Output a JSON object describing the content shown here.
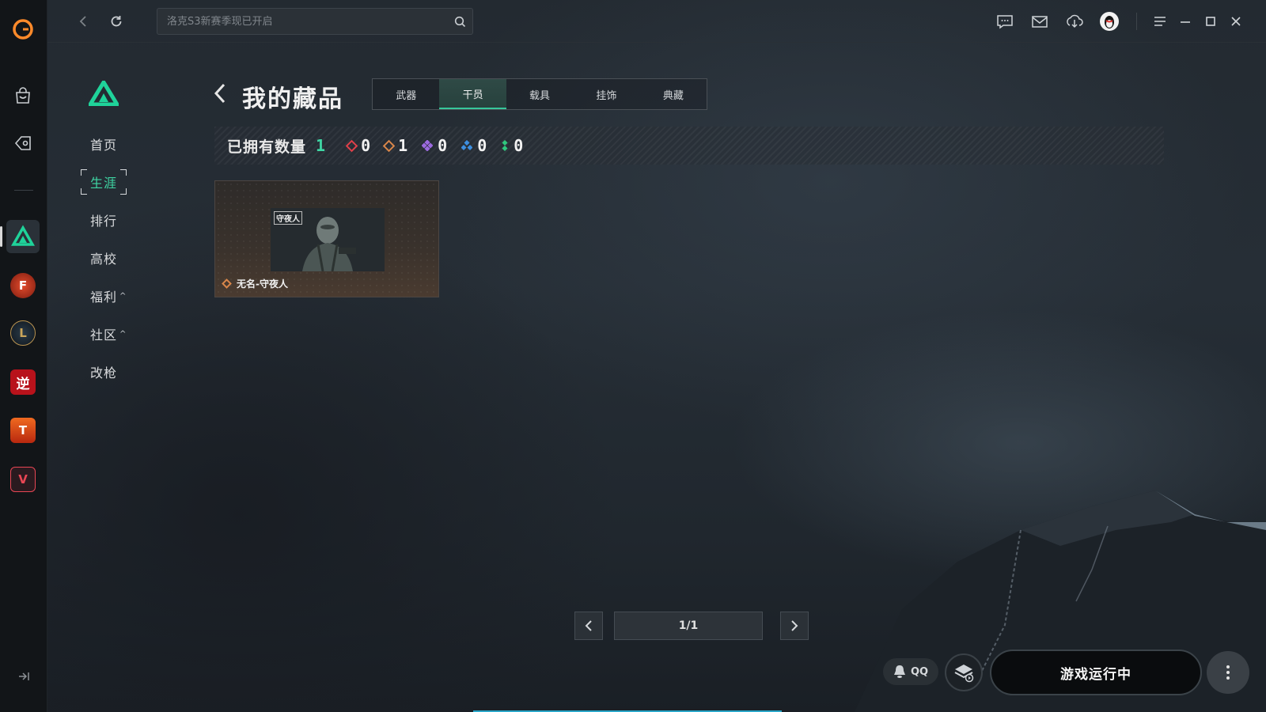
{
  "search": {
    "placeholder": "洛克S3新赛季现已开启"
  },
  "sidebar": {
    "items": [
      {
        "label": "首页",
        "caret": ""
      },
      {
        "label": "生涯",
        "caret": ""
      },
      {
        "label": "排行",
        "caret": ""
      },
      {
        "label": "高校",
        "caret": ""
      },
      {
        "label": "福利",
        "caret": "^"
      },
      {
        "label": "社区",
        "caret": "^"
      },
      {
        "label": "改枪",
        "caret": ""
      }
    ],
    "active_index": 1
  },
  "rail": {
    "games": [
      {
        "name": "delta-force",
        "glyph": "▲",
        "color": "#1fd39a"
      },
      {
        "name": "crossfire",
        "glyph": "F",
        "color": "#c4351f"
      },
      {
        "name": "league-of-legends",
        "glyph": "L",
        "color": "#b99350"
      },
      {
        "name": "nishuihan",
        "glyph": "逆",
        "color": "#b8121b"
      },
      {
        "name": "team-game",
        "glyph": "T",
        "color": "#e0511a"
      },
      {
        "name": "valorant",
        "glyph": "V",
        "color": "#e84654"
      }
    ]
  },
  "main": {
    "title": "我的藏品",
    "tabs": [
      {
        "label": "武器"
      },
      {
        "label": "干员"
      },
      {
        "label": "载具"
      },
      {
        "label": "挂饰"
      },
      {
        "label": "典藏"
      }
    ],
    "active_tab": 1,
    "stats": {
      "label": "已拥有数量",
      "total": "1",
      "rarities": [
        {
          "name": "red",
          "color": "#e0404a",
          "count": "0"
        },
        {
          "name": "gold",
          "color": "#d9864a",
          "count": "1"
        },
        {
          "name": "purple",
          "color": "#9c6ae0",
          "count": "0"
        },
        {
          "name": "blue",
          "color": "#3d8fe0",
          "count": "0"
        },
        {
          "name": "green",
          "color": "#2fc77e",
          "count": "0"
        }
      ]
    },
    "items": [
      {
        "name": "无名-守夜人",
        "tag": "守夜人",
        "rarity_color": "#d9864a"
      }
    ],
    "pagination": {
      "label": "1/1"
    }
  },
  "bottom": {
    "qq_label": "QQ",
    "launch_label": "游戏运行中"
  }
}
